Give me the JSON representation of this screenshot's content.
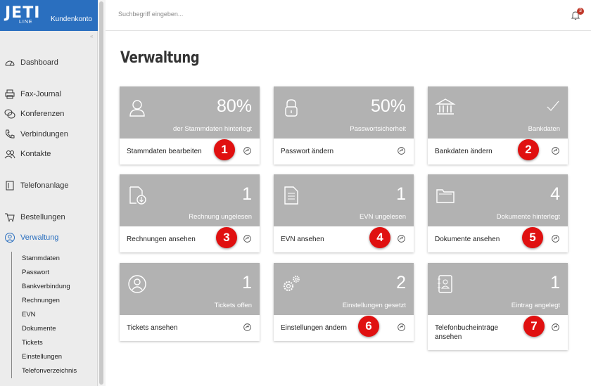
{
  "brand": {
    "logo": "JETI",
    "logo_sub": "LINE",
    "title": "Kundenkonto"
  },
  "search": {
    "placeholder": "Suchbegriff eingeben..."
  },
  "notifications": {
    "count": "3"
  },
  "sidebar": {
    "items": [
      {
        "label": "Dashboard",
        "icon": "gauge-icon"
      },
      {
        "label": "Fax-Journal",
        "icon": "printer-icon"
      },
      {
        "label": "Konferenzen",
        "icon": "chat-icon"
      },
      {
        "label": "Verbindungen",
        "icon": "phone-icon"
      },
      {
        "label": "Kontakte",
        "icon": "users-icon"
      },
      {
        "label": "Telefonanlage",
        "icon": "phone-system-icon"
      },
      {
        "label": "Bestellungen",
        "icon": "cart-icon"
      },
      {
        "label": "Verwaltung",
        "icon": "user-circle-icon"
      }
    ],
    "subitems": [
      "Stammdaten",
      "Passwort",
      "Bankverbindung",
      "Rechnungen",
      "EVN",
      "Dokumente",
      "Tickets",
      "Einstellungen",
      "Telefonverzeichnis"
    ]
  },
  "main": {
    "title": "Verwaltung",
    "cards": [
      {
        "big": "80%",
        "caption": "der Stammdaten hinterlegt",
        "action": "Stammdaten bearbeiten",
        "badge": "1",
        "icon": "user-icon"
      },
      {
        "big": "50%",
        "caption": "Passwortsicherheit",
        "action": "Passwort ändern",
        "badge": "",
        "icon": "lock-icon"
      },
      {
        "big": "",
        "caption": "Bankdaten",
        "action": "Bankdaten ändern",
        "badge": "2",
        "icon": "bank-icon"
      },
      {
        "big": "1",
        "caption": "Rechnung ungelesen",
        "action": "Rechnungen ansehen",
        "badge": "3",
        "icon": "invoice-download-icon"
      },
      {
        "big": "1",
        "caption": "EVN ungelesen",
        "action": "EVN ansehen",
        "badge": "4",
        "icon": "document-icon"
      },
      {
        "big": "4",
        "caption": "Dokumente hinterlegt",
        "action": "Dokumente ansehen",
        "badge": "5",
        "icon": "folder-icon"
      },
      {
        "big": "1",
        "caption": "Tickets offen",
        "action": "Tickets ansehen",
        "badge": "",
        "icon": "support-ticket-icon"
      },
      {
        "big": "2",
        "caption": "Einstellungen gesetzt",
        "action": "Einstellungen ändern",
        "badge": "6",
        "icon": "gears-icon"
      },
      {
        "big": "1",
        "caption": "Eintrag angelegt",
        "action": "Telefonbucheinträge ansehen",
        "badge": "7",
        "icon": "phonebook-icon"
      }
    ]
  },
  "colors": {
    "brand": "#2a6fbf",
    "card_top": "#b2b2b2",
    "badge": "#e01010"
  }
}
